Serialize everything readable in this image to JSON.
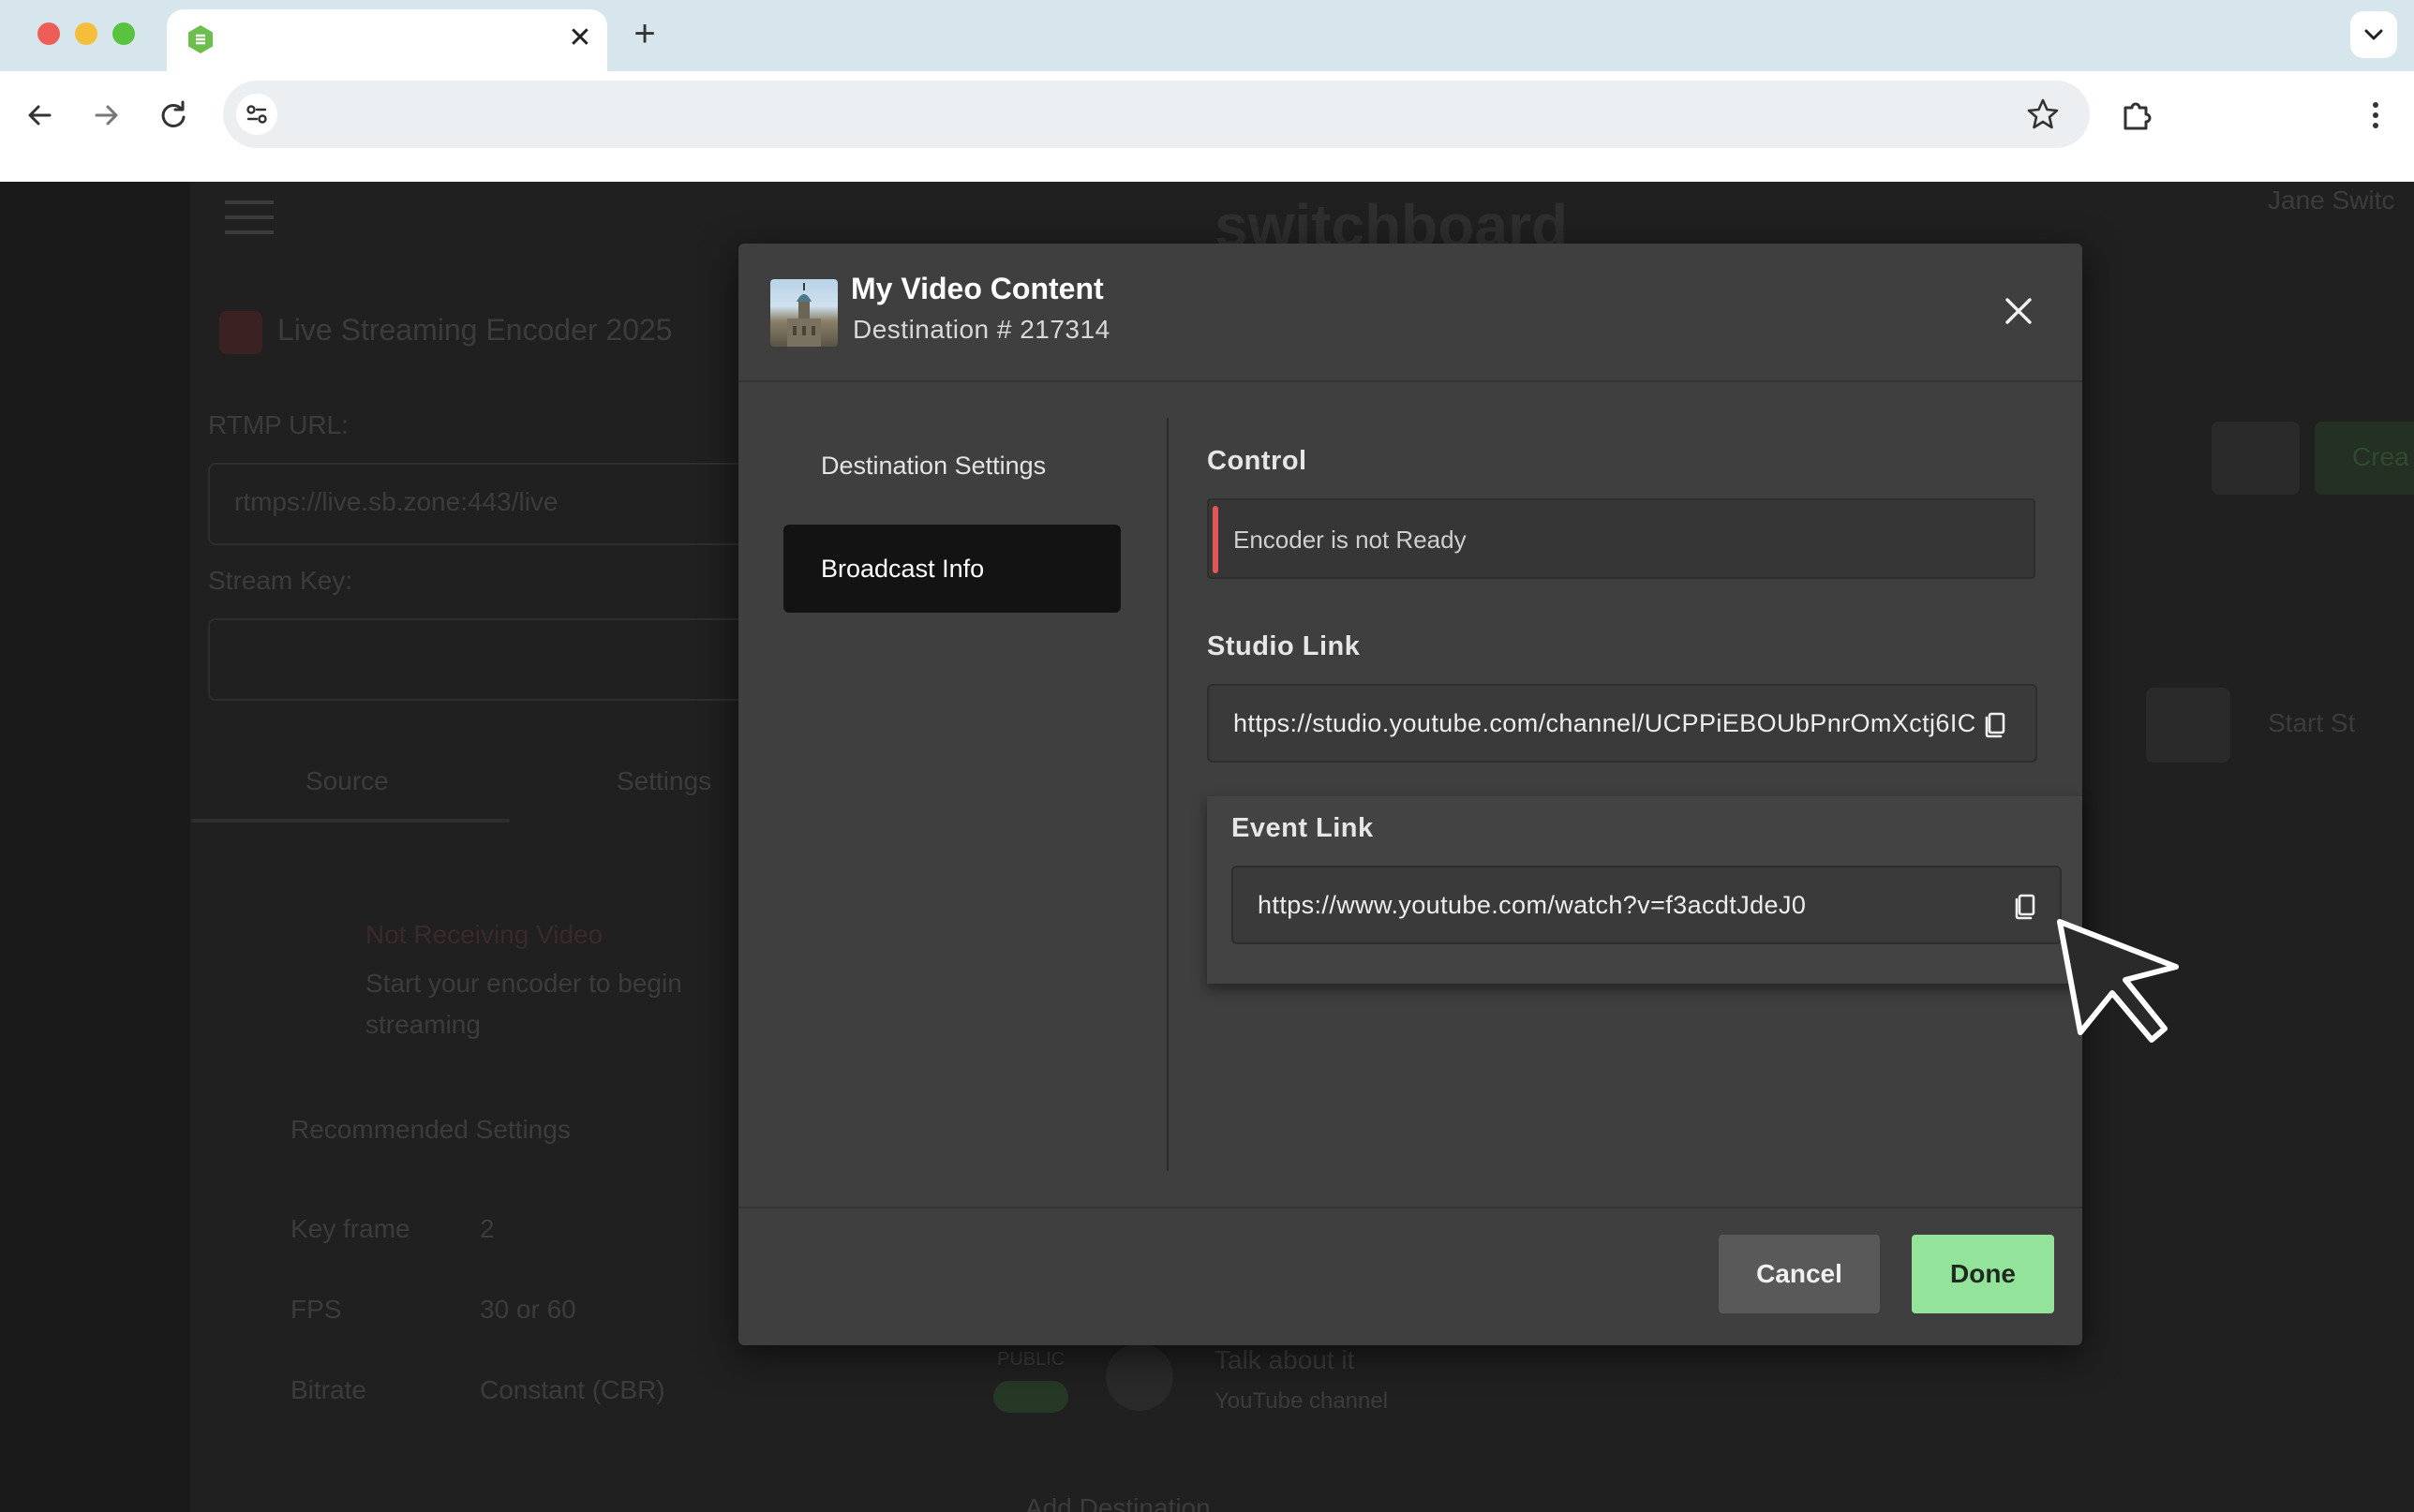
{
  "browser": {
    "tab_close_glyph": "✕",
    "new_tab_glyph": "+",
    "icons": [
      "back-icon",
      "forward-icon",
      "reload-icon",
      "site-info-icon",
      "bookmark-star-icon",
      "extensions-icon",
      "more-menu-icon",
      "tab-list-chevron-icon"
    ]
  },
  "background_page": {
    "brand": "switchboard",
    "user_name": "Jane Switc",
    "encoder_title": "Live Streaming Encoder 2025",
    "rtmp_label": "RTMP URL:",
    "rtmp_value": "rtmps://live.sb.zone:443/live",
    "stream_key_label": "Stream Key:",
    "tabs": [
      "Source",
      "Settings"
    ],
    "status_title": "Not Receiving Video",
    "status_body": "Start your encoder to begin streaming",
    "recommended_title": "Recommended Settings",
    "settings": [
      {
        "label": "Key frame",
        "value": "2"
      },
      {
        "label": "FPS",
        "value": "30 or 60"
      },
      {
        "label": "Bitrate",
        "value": "Constant (CBR)"
      }
    ],
    "create_label": "Crea",
    "start_label": "Start St",
    "public_label": "PUBLIC",
    "channel_title": "Talk about it",
    "channel_sub": "YouTube channel",
    "add_label": "Add Destination"
  },
  "modal": {
    "title": "My Video Content",
    "subtitle": "Destination # 217314",
    "nav": [
      {
        "label": "Destination Settings",
        "active": false
      },
      {
        "label": "Broadcast Info",
        "active": true
      }
    ],
    "control": {
      "label": "Control",
      "status": "Encoder is not Ready",
      "status_color": "#e0575a"
    },
    "studio_link": {
      "label": "Studio Link",
      "value": "https://studio.youtube.com/channel/UCPPiEBOUbPnrOmXctj6IC"
    },
    "event_link": {
      "label": "Event Link",
      "value": "https://www.youtube.com/watch?v=f3acdtJdeJ0"
    },
    "buttons": {
      "cancel": "Cancel",
      "done": "Done",
      "done_color": "#93e39a"
    }
  }
}
